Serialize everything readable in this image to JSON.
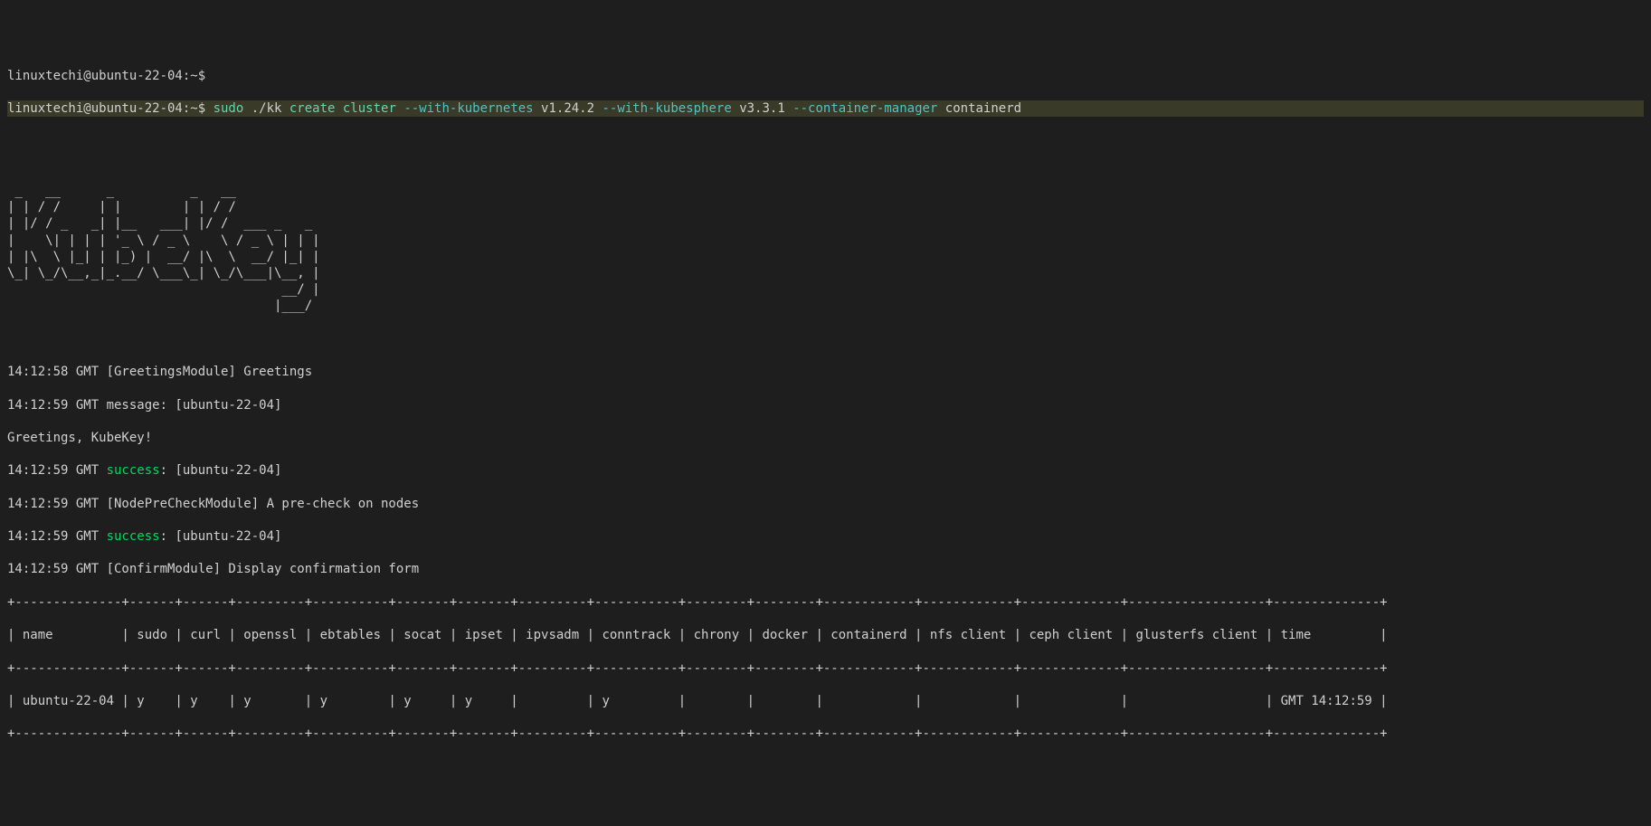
{
  "prompt1": "linuxtechi@ubuntu-22-04:~$",
  "prompt2": "linuxtechi@ubuntu-22-04:~$ ",
  "command": {
    "sudo": "sudo",
    "binary": " ./kk ",
    "action": "create cluster ",
    "flag1": "--with-kubernetes",
    "val1": " v1.24.2 ",
    "flag2": "--with-kubesphere",
    "val2": " v3.3.1 ",
    "flag3": "--container-manager",
    "val3": " containerd"
  },
  "ascii": " _   __      _          _   __\n| | / /     | |        | | / /\n| |/ / _   _| |__   ___| |/ /  ___ _   _\n|    \\| | | | '_ \\ / _ \\    \\ / _ \\ | | |\n| |\\  \\ |_| | |_) |  __/ |\\  \\  __/ |_| |\n\\_| \\_/\\__,_|_.__/ \\___\\_| \\_/\\___|\\__, |\n                                    __/ |\n                                   |___/",
  "log": {
    "l1": "14:12:58 GMT [GreetingsModule] Greetings",
    "l2": "14:12:59 GMT message: [ubuntu-22-04]",
    "l3": "Greetings, KubeKey!",
    "l4a": "14:12:59 GMT ",
    "l4b": "success",
    "l4c": ": [ubuntu-22-04]",
    "l5": "14:12:59 GMT [NodePreCheckModule] A pre-check on nodes",
    "l6a": "14:12:59 GMT ",
    "l6b": "success",
    "l6c": ": [ubuntu-22-04]",
    "l7": "14:12:59 GMT [ConfirmModule] Display confirmation form"
  },
  "table": {
    "border": "+--------------+------+------+---------+----------+-------+-------+---------+-----------+--------+--------+------------+------------+-------------+------------------+--------------+",
    "header": "| name         | sudo | curl | openssl | ebtables | socat | ipset | ipvsadm | conntrack | chrony | docker | containerd | nfs client | ceph client | glusterfs client | time         |",
    "row": "| ubuntu-22-04 | y    | y    | y       | y        | y     | y     |         | y         |        |        |            |            |             |                  | GMT 14:12:59 |"
  }
}
